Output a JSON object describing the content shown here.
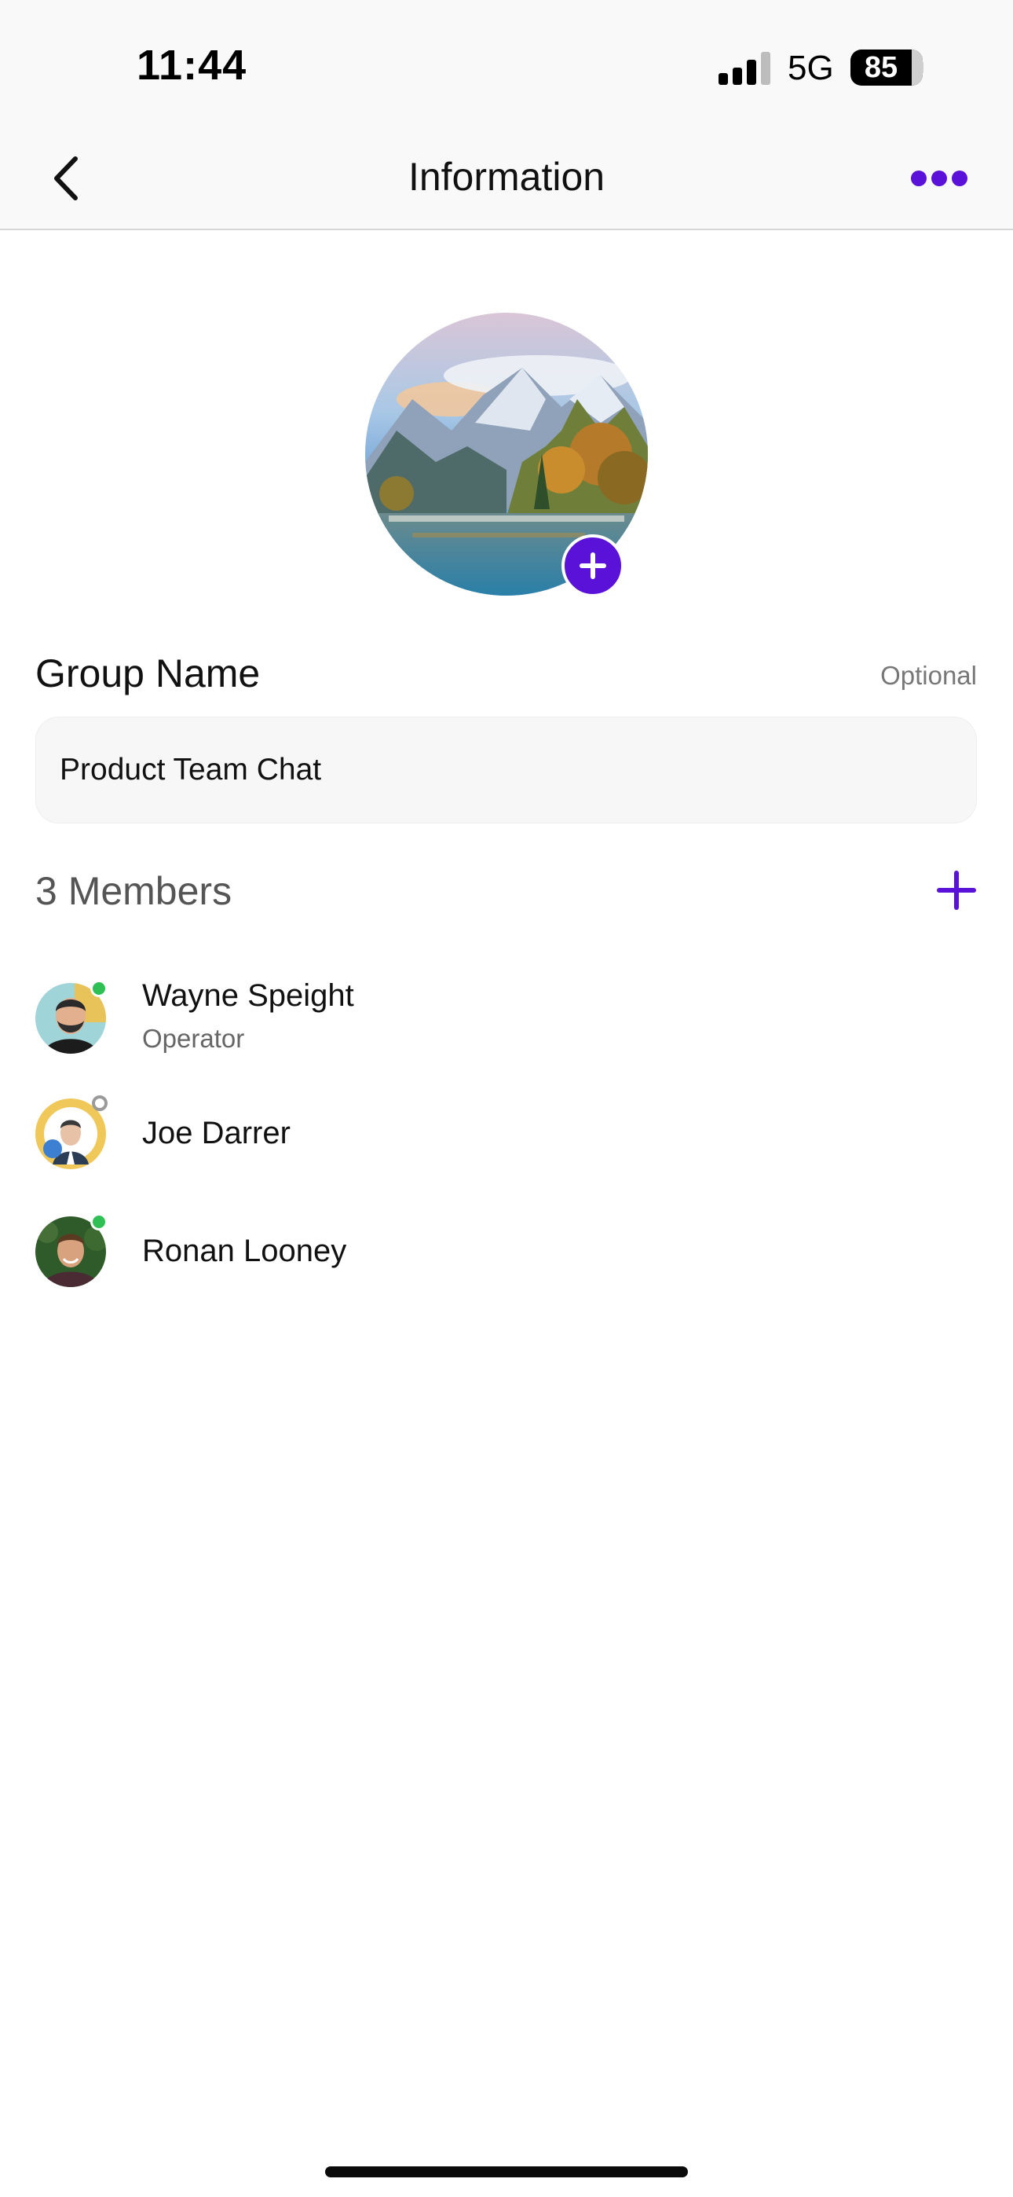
{
  "status_bar": {
    "time": "11:44",
    "network": "5G",
    "battery": "85"
  },
  "nav": {
    "title": "Information",
    "back_icon": "chevron-left-icon",
    "more_icon": "ellipsis-icon"
  },
  "group": {
    "photo_icon": "landscape-photo",
    "add_photo_icon": "plus-circle-icon",
    "name_label": "Group Name",
    "optional_label": "Optional",
    "name_value": "Product Team Chat"
  },
  "members": {
    "title": "3 Members",
    "add_icon": "plus-icon",
    "items": [
      {
        "name": "Wayne Speight",
        "role": "Operator",
        "status": "online"
      },
      {
        "name": "Joe Darrer",
        "role": "",
        "status": "offline"
      },
      {
        "name": "Ronan Looney",
        "role": "",
        "status": "online"
      }
    ]
  },
  "colors": {
    "accent": "#5a12d8",
    "online": "#2fbf55",
    "offline": "#9a9a9a"
  }
}
